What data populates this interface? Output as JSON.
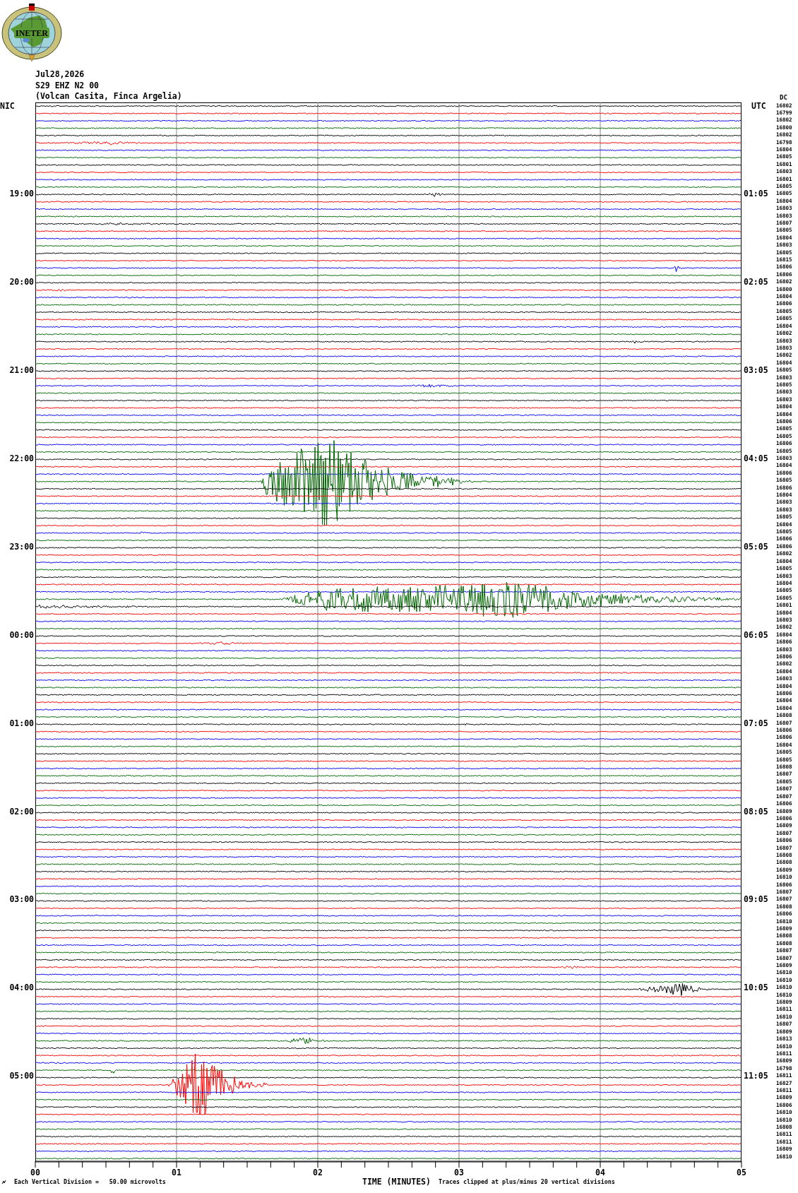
{
  "logo": {
    "text": "INETER"
  },
  "header": {
    "date": "Jul28,2026",
    "station": "S29 EHZ N2 00",
    "location": "(Volcan Casita, Finca Argelia)",
    "reading_heading": "DC"
  },
  "plot": {
    "left_heading": "NIC",
    "right_heading": "UTC",
    "traces": [
      {
        "reading": "16802",
        "color": "#000000"
      },
      {
        "reading": "16799",
        "color": "#ff0000"
      },
      {
        "reading": "16802",
        "color": "#0000ff"
      },
      {
        "reading": "16800",
        "color": "#006400"
      },
      {
        "reading": "16802",
        "color": "#000000"
      },
      {
        "reading": "16798",
        "color": "#ff0000"
      },
      {
        "reading": "16804",
        "color": "#0000ff"
      },
      {
        "reading": "16805",
        "color": "#006400"
      },
      {
        "reading": "16801",
        "color": "#000000"
      },
      {
        "reading": "16803",
        "color": "#ff0000"
      },
      {
        "reading": "16801",
        "color": "#0000ff"
      },
      {
        "reading": "16805",
        "color": "#006400"
      },
      {
        "reading": "16805",
        "color": "#000000",
        "left_time": "19:00",
        "right_time": "01:05"
      },
      {
        "reading": "16804",
        "color": "#ff0000"
      },
      {
        "reading": "16803",
        "color": "#0000ff"
      },
      {
        "reading": "16803",
        "color": "#006400"
      },
      {
        "reading": "16807",
        "color": "#000000"
      },
      {
        "reading": "16805",
        "color": "#ff0000"
      },
      {
        "reading": "16804",
        "color": "#0000ff"
      },
      {
        "reading": "16803",
        "color": "#006400"
      },
      {
        "reading": "16805",
        "color": "#000000"
      },
      {
        "reading": "16815",
        "color": "#ff0000"
      },
      {
        "reading": "16806",
        "color": "#0000ff"
      },
      {
        "reading": "16806",
        "color": "#006400"
      },
      {
        "reading": "16802",
        "color": "#000000",
        "left_time": "20:00",
        "right_time": "02:05"
      },
      {
        "reading": "16800",
        "color": "#ff0000"
      },
      {
        "reading": "16804",
        "color": "#0000ff"
      },
      {
        "reading": "16806",
        "color": "#006400"
      },
      {
        "reading": "16805",
        "color": "#000000"
      },
      {
        "reading": "16805",
        "color": "#ff0000"
      },
      {
        "reading": "16804",
        "color": "#0000ff"
      },
      {
        "reading": "16802",
        "color": "#006400"
      },
      {
        "reading": "16803",
        "color": "#000000"
      },
      {
        "reading": "16803",
        "color": "#ff0000"
      },
      {
        "reading": "16802",
        "color": "#0000ff"
      },
      {
        "reading": "16804",
        "color": "#006400"
      },
      {
        "reading": "16805",
        "color": "#000000",
        "left_time": "21:00",
        "right_time": "03:05"
      },
      {
        "reading": "16803",
        "color": "#ff0000"
      },
      {
        "reading": "16805",
        "color": "#0000ff"
      },
      {
        "reading": "16803",
        "color": "#006400"
      },
      {
        "reading": "16803",
        "color": "#000000"
      },
      {
        "reading": "16804",
        "color": "#ff0000"
      },
      {
        "reading": "16804",
        "color": "#0000ff"
      },
      {
        "reading": "16806",
        "color": "#006400"
      },
      {
        "reading": "16805",
        "color": "#000000"
      },
      {
        "reading": "16805",
        "color": "#ff0000"
      },
      {
        "reading": "16806",
        "color": "#0000ff"
      },
      {
        "reading": "16805",
        "color": "#006400"
      },
      {
        "reading": "16803",
        "color": "#000000",
        "left_time": "22:00",
        "right_time": "04:05"
      },
      {
        "reading": "16804",
        "color": "#ff0000"
      },
      {
        "reading": "16806",
        "color": "#0000ff"
      },
      {
        "reading": "16805",
        "color": "#006400"
      },
      {
        "reading": "16806",
        "color": "#000000"
      },
      {
        "reading": "16804",
        "color": "#ff0000"
      },
      {
        "reading": "16803",
        "color": "#0000ff"
      },
      {
        "reading": "16803",
        "color": "#006400"
      },
      {
        "reading": "16805",
        "color": "#000000"
      },
      {
        "reading": "16804",
        "color": "#ff0000"
      },
      {
        "reading": "16805",
        "color": "#0000ff"
      },
      {
        "reading": "16806",
        "color": "#006400"
      },
      {
        "reading": "16806",
        "color": "#000000",
        "left_time": "23:00",
        "right_time": "05:05"
      },
      {
        "reading": "16802",
        "color": "#ff0000"
      },
      {
        "reading": "16804",
        "color": "#0000ff"
      },
      {
        "reading": "16805",
        "color": "#006400"
      },
      {
        "reading": "16803",
        "color": "#000000"
      },
      {
        "reading": "16804",
        "color": "#ff0000"
      },
      {
        "reading": "16805",
        "color": "#0000ff"
      },
      {
        "reading": "16805",
        "color": "#006400"
      },
      {
        "reading": "16801",
        "color": "#000000"
      },
      {
        "reading": "16804",
        "color": "#ff0000"
      },
      {
        "reading": "16803",
        "color": "#0000ff"
      },
      {
        "reading": "16802",
        "color": "#006400"
      },
      {
        "reading": "16804",
        "color": "#000000",
        "left_time": "00:00",
        "right_time": "06:05"
      },
      {
        "reading": "16806",
        "color": "#ff0000"
      },
      {
        "reading": "16803",
        "color": "#0000ff"
      },
      {
        "reading": "16806",
        "color": "#006400"
      },
      {
        "reading": "16802",
        "color": "#000000"
      },
      {
        "reading": "16804",
        "color": "#ff0000"
      },
      {
        "reading": "16803",
        "color": "#0000ff"
      },
      {
        "reading": "16804",
        "color": "#006400"
      },
      {
        "reading": "16806",
        "color": "#000000"
      },
      {
        "reading": "16804",
        "color": "#ff0000"
      },
      {
        "reading": "16804",
        "color": "#0000ff"
      },
      {
        "reading": "16808",
        "color": "#006400"
      },
      {
        "reading": "16807",
        "color": "#000000",
        "left_time": "01:00",
        "right_time": "07:05"
      },
      {
        "reading": "16806",
        "color": "#ff0000"
      },
      {
        "reading": "16806",
        "color": "#0000ff"
      },
      {
        "reading": "16804",
        "color": "#006400"
      },
      {
        "reading": "16805",
        "color": "#000000"
      },
      {
        "reading": "16805",
        "color": "#ff0000"
      },
      {
        "reading": "16808",
        "color": "#0000ff"
      },
      {
        "reading": "16807",
        "color": "#006400"
      },
      {
        "reading": "16805",
        "color": "#000000"
      },
      {
        "reading": "16807",
        "color": "#ff0000"
      },
      {
        "reading": "16807",
        "color": "#0000ff"
      },
      {
        "reading": "16806",
        "color": "#006400"
      },
      {
        "reading": "16809",
        "color": "#000000",
        "left_time": "02:00",
        "right_time": "08:05"
      },
      {
        "reading": "16806",
        "color": "#ff0000"
      },
      {
        "reading": "16809",
        "color": "#0000ff"
      },
      {
        "reading": "16807",
        "color": "#006400"
      },
      {
        "reading": "16806",
        "color": "#000000"
      },
      {
        "reading": "16807",
        "color": "#ff0000"
      },
      {
        "reading": "16808",
        "color": "#0000ff"
      },
      {
        "reading": "16808",
        "color": "#006400"
      },
      {
        "reading": "16809",
        "color": "#000000"
      },
      {
        "reading": "16810",
        "color": "#ff0000"
      },
      {
        "reading": "16806",
        "color": "#0000ff"
      },
      {
        "reading": "16807",
        "color": "#006400"
      },
      {
        "reading": "16807",
        "color": "#000000",
        "left_time": "03:00",
        "right_time": "09:05"
      },
      {
        "reading": "16808",
        "color": "#ff0000"
      },
      {
        "reading": "16806",
        "color": "#0000ff"
      },
      {
        "reading": "16810",
        "color": "#006400"
      },
      {
        "reading": "16809",
        "color": "#000000"
      },
      {
        "reading": "16808",
        "color": "#ff0000"
      },
      {
        "reading": "16808",
        "color": "#0000ff"
      },
      {
        "reading": "16807",
        "color": "#006400"
      },
      {
        "reading": "16807",
        "color": "#000000"
      },
      {
        "reading": "16809",
        "color": "#ff0000"
      },
      {
        "reading": "16810",
        "color": "#0000ff"
      },
      {
        "reading": "16810",
        "color": "#006400"
      },
      {
        "reading": "16810",
        "color": "#000000",
        "left_time": "04:00",
        "right_time": "10:05"
      },
      {
        "reading": "16810",
        "color": "#ff0000"
      },
      {
        "reading": "16809",
        "color": "#0000ff"
      },
      {
        "reading": "16811",
        "color": "#006400"
      },
      {
        "reading": "16810",
        "color": "#000000"
      },
      {
        "reading": "16807",
        "color": "#ff0000"
      },
      {
        "reading": "16809",
        "color": "#0000ff"
      },
      {
        "reading": "16813",
        "color": "#006400"
      },
      {
        "reading": "16810",
        "color": "#000000"
      },
      {
        "reading": "16811",
        "color": "#ff0000"
      },
      {
        "reading": "16809",
        "color": "#0000ff"
      },
      {
        "reading": "16798",
        "color": "#006400"
      },
      {
        "reading": "16811",
        "color": "#000000",
        "left_time": "05:00",
        "right_time": "11:05"
      },
      {
        "reading": "16827",
        "color": "#ff0000"
      },
      {
        "reading": "16811",
        "color": "#0000ff"
      },
      {
        "reading": "16809",
        "color": "#006400"
      },
      {
        "reading": "16806",
        "color": "#000000"
      },
      {
        "reading": "16810",
        "color": "#ff0000"
      },
      {
        "reading": "16810",
        "color": "#0000ff"
      },
      {
        "reading": "16808",
        "color": "#006400"
      },
      {
        "reading": "16811",
        "color": "#000000"
      },
      {
        "reading": "16811",
        "color": "#ff0000"
      },
      {
        "reading": "16809",
        "color": "#0000ff"
      },
      {
        "reading": "16810",
        "color": "#006400"
      }
    ]
  },
  "axis": {
    "labels": [
      "00",
      "01",
      "02",
      "03",
      "04",
      "05"
    ],
    "title": "TIME (MINUTES)"
  },
  "footer": {
    "scale_note": "Each Vertical Division =   50.00 microvolts",
    "clip_note": "Traces clipped at plus/minus 20 vertical divisions"
  }
}
